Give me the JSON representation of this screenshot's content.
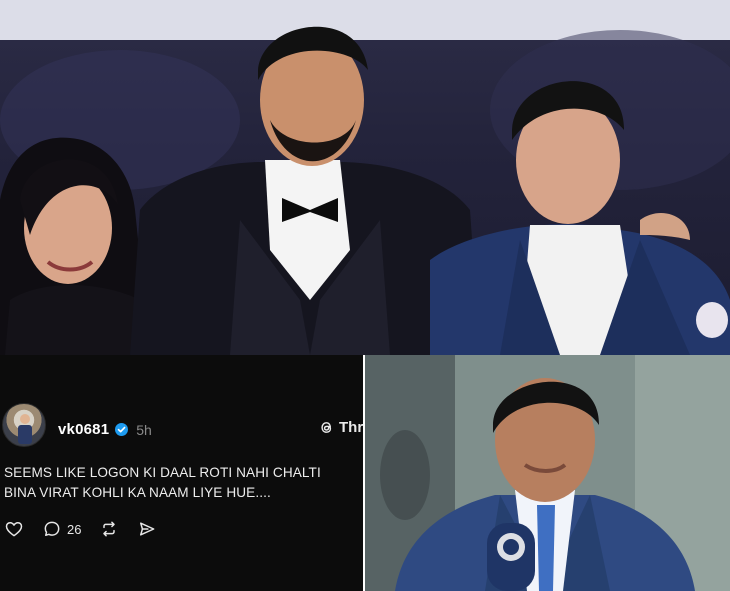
{
  "post": {
    "username": "vk0681",
    "time": "5h",
    "brand": "Thr",
    "text_line1": "SEEMS LIKE LOGON KI DAAL ROTI NAHI CHALTI",
    "text_line2": "BINA VIRAT KOHLI KA NAAM LIYE HUE....",
    "reply_count": "26"
  },
  "icons": {
    "verified": "verified-badge-icon",
    "threads": "threads-logo-icon",
    "like": "heart-icon",
    "reply": "comment-icon",
    "repost": "repost-icon",
    "share": "send-icon"
  },
  "colors": {
    "post_background": "#0c0c0c",
    "verified_blue": "#1d9bf0",
    "muted_text": "#8a8a8a"
  }
}
